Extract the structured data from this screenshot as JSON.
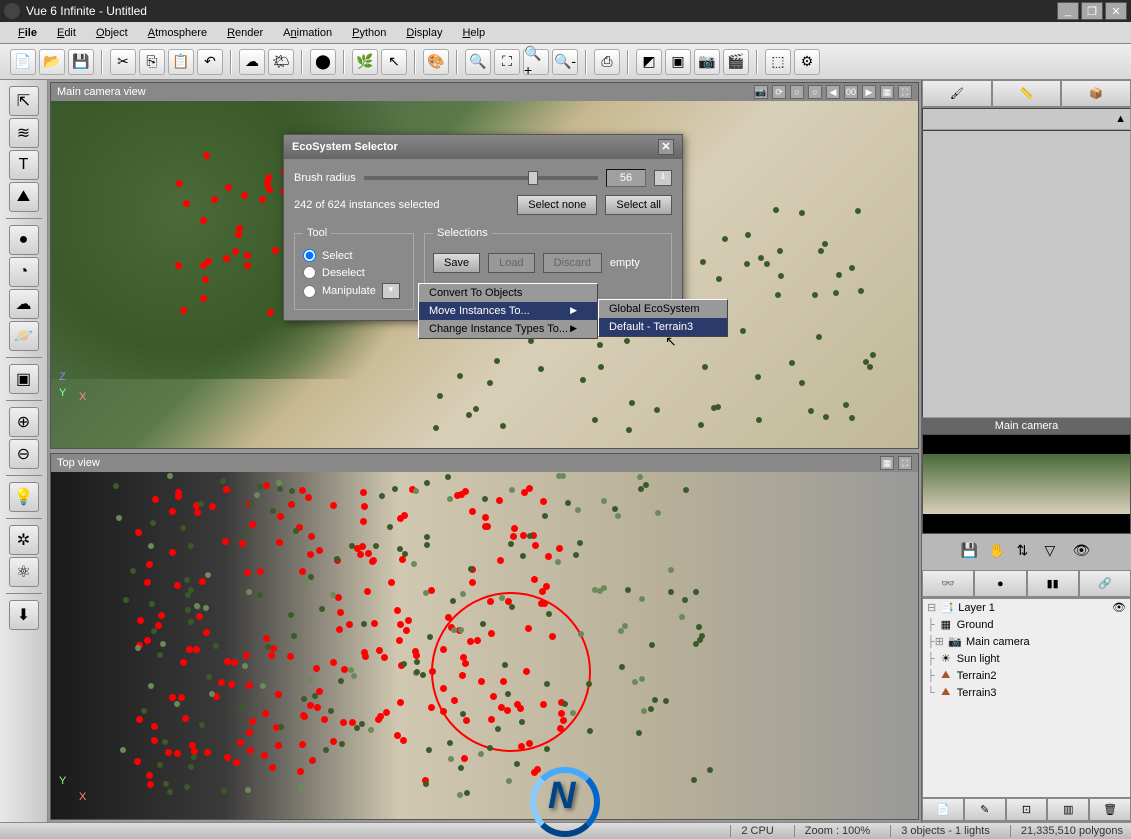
{
  "window": {
    "title": "Vue 6 Infinite - Untitled"
  },
  "menus": [
    "File",
    "Edit",
    "Object",
    "Atmosphere",
    "Render",
    "Animation",
    "Python",
    "Display",
    "Help"
  ],
  "viewports": {
    "main": {
      "label": "Main camera view"
    },
    "top": {
      "label": "Top view"
    }
  },
  "dialog": {
    "title": "EcoSystem Selector",
    "brush_label": "Brush radius",
    "brush_value": "56",
    "selection_info": "242 of 624 instances selected",
    "btn_select_none": "Select none",
    "btn_select_all": "Select all",
    "group_tool": "Tool",
    "radio_select": "Select",
    "radio_deselect": "Deselect",
    "radio_manipulate": "Manipulate",
    "group_selections": "Selections",
    "btn_save": "Save",
    "btn_load": "Load",
    "btn_discard": "Discard",
    "sel_state": "empty"
  },
  "context1": {
    "convert": "Convert To Objects",
    "move": "Move Instances To...",
    "change": "Change Instance Types To..."
  },
  "context2": {
    "global": "Global EcoSystem",
    "default": "Default - Terrain3"
  },
  "preview": {
    "label": "Main camera"
  },
  "layers": {
    "layer1": "Layer 1",
    "ground": "Ground",
    "camera": "Main camera",
    "sun": "Sun light",
    "terrain2": "Terrain2",
    "terrain3": "Terrain3"
  },
  "status": {
    "cpu": "2 CPU",
    "zoom": "Zoom : 100%",
    "sel": "3 objects - 1 lights",
    "poly": "21,335,510 polygons"
  }
}
